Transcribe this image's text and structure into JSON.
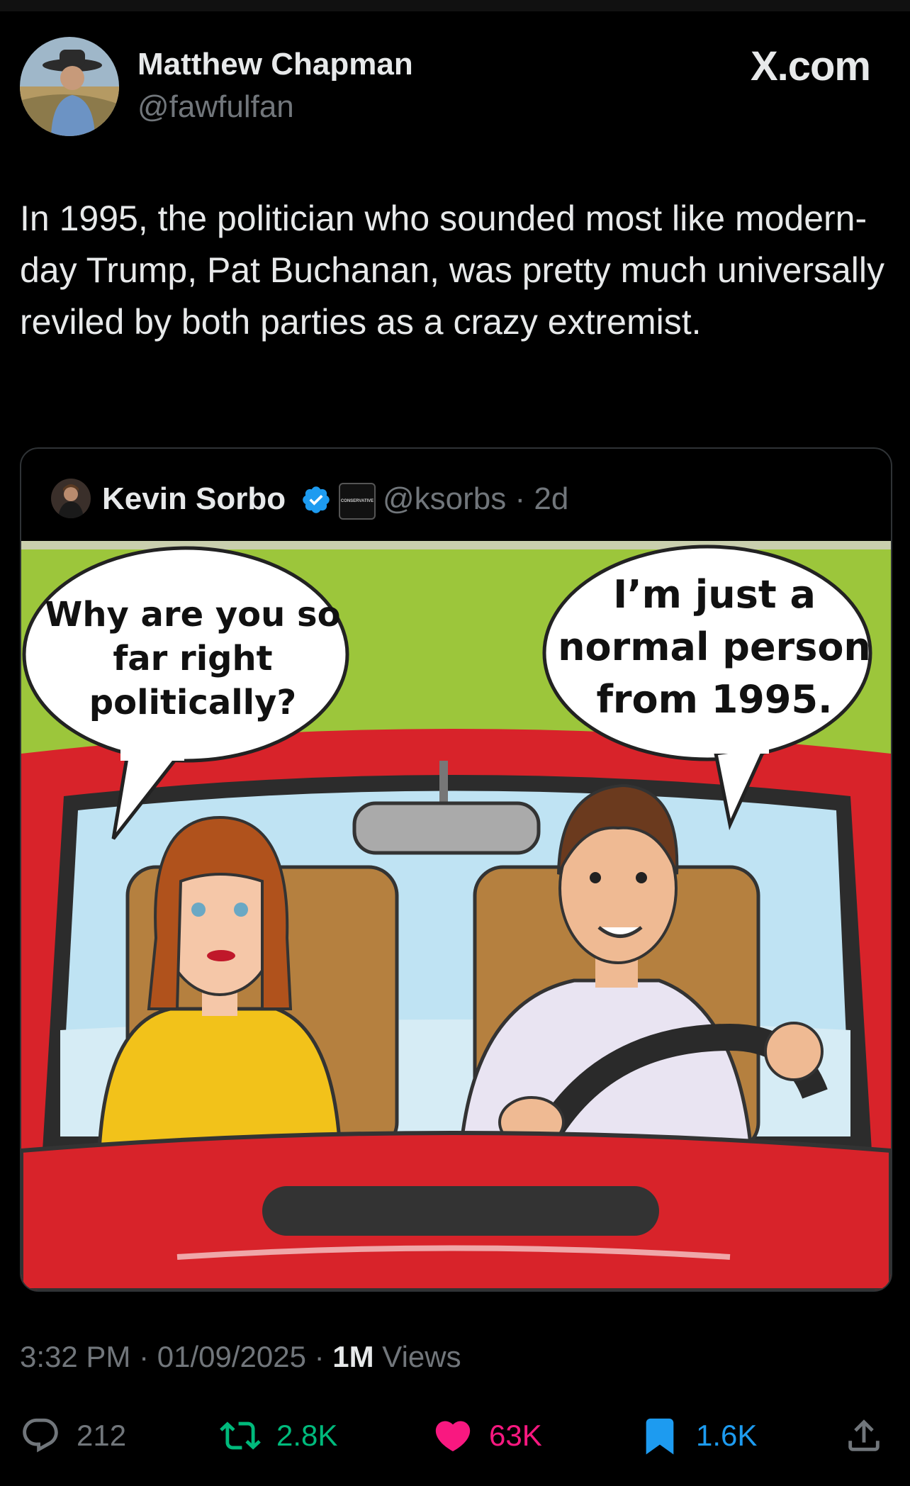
{
  "header": {
    "name": "Matthew Chapman",
    "handle": "@fawfulfan",
    "site": "X.com"
  },
  "tweet": {
    "text": "In 1995, the politician who sounded most like modern-day Trump, Pat Buchanan, was pretty much universally reviled by both parties as a crazy extremist."
  },
  "quote": {
    "name": "Kevin Sorbo",
    "badge_text": "CONSERVATIVE",
    "handle_time": "@ksorbs · 2d",
    "image": {
      "bubble_left": [
        "Why are you so",
        "far right",
        "politically?"
      ],
      "bubble_right": [
        "I’m just a",
        "normal person",
        "from 1995."
      ]
    }
  },
  "meta": {
    "time": "3:32 PM · 01/09/2025 · ",
    "views_count": "1M",
    "views_label": " Views"
  },
  "actions": {
    "replies": "212",
    "reposts": "2.8K",
    "likes": "63K",
    "bookmarks": "1.6K"
  },
  "colors": {
    "background": "#000000",
    "text": "#e7e9ea",
    "secondary": "#71767b",
    "repost": "#00ba7c",
    "like": "#f91880",
    "bookmark": "#1d9bf0",
    "verified": "#1d9bf0"
  }
}
